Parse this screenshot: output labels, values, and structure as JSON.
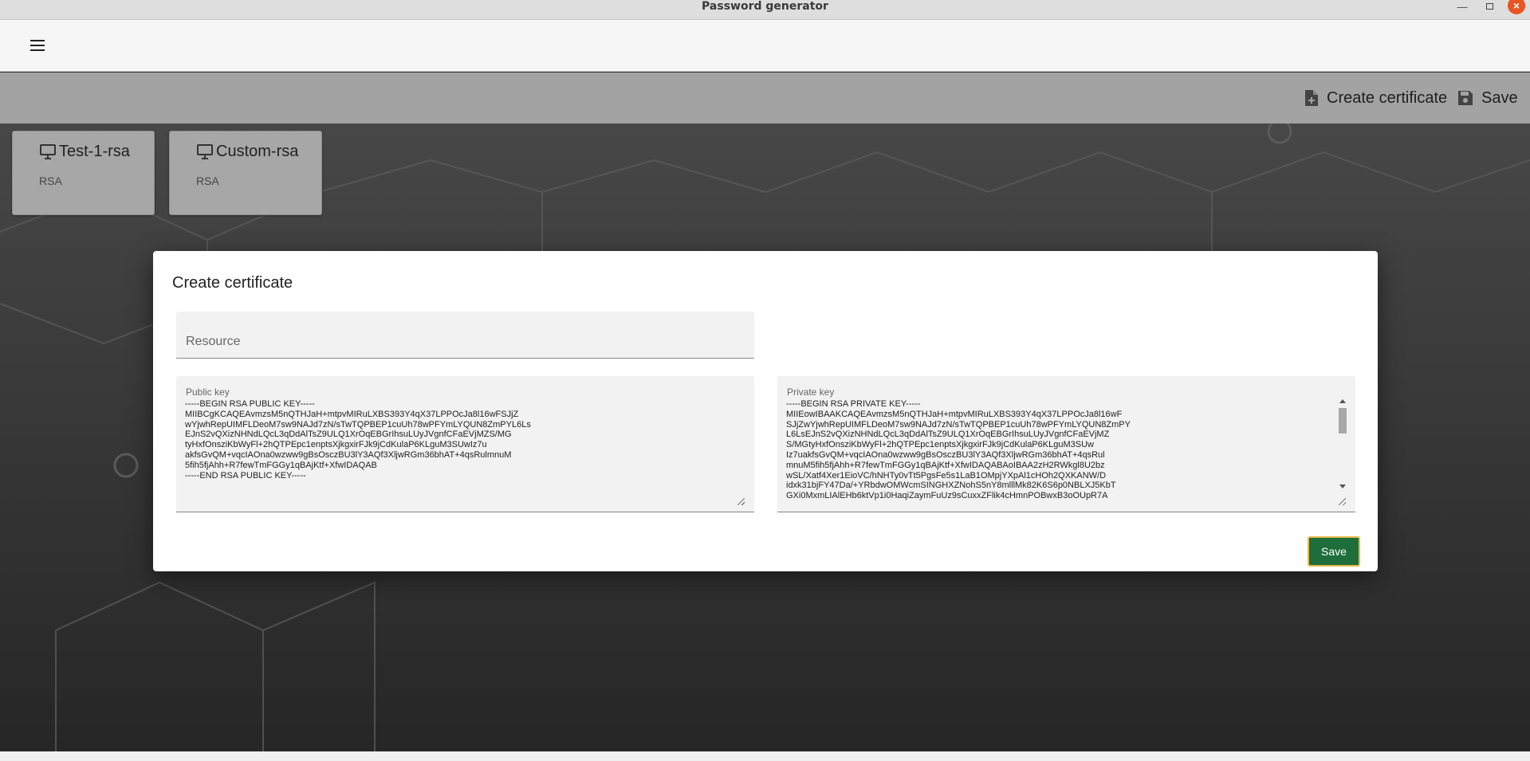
{
  "window": {
    "title": "Password generator"
  },
  "toolbar": {
    "create_label": "Create certificate",
    "save_label": "Save"
  },
  "certificates": [
    {
      "name": "Test-1-rsa",
      "type": "RSA"
    },
    {
      "name": "Custom-rsa",
      "type": "RSA"
    }
  ],
  "dialog": {
    "title": "Create certificate",
    "resource_placeholder": "Resource",
    "resource_value": "",
    "public_key_label": "Public key",
    "public_key": "-----BEGIN RSA PUBLIC KEY-----\nMIIBCgKCAQEAvmzsM5nQTHJaH+mtpvMIRuLXBS393Y4qX37LPPOcJa8l16wFSJjZ\nwYjwhRepUIMFLDeoM7sw9NAJd7zN/sTwTQPBEP1cuUh78wPFYmLYQUN8ZmPYL6Ls\nEJnS2vQXizNHNdLQcL3qDdAlTsZ9ULQ1XrOqEBGrIhsuLUyJVgnfCFaEVjMZS/MG\ntyHxfOnsziKbWyFl+2hQTPEpc1enptsXjkgxirFJk9jCdKulaP6KLguM3SUwIz7u\nakfsGvQM+vqcIAOna0wzww9gBsOsczBU3lY3AQf3XljwRGm36bhAT+4qsRulmnuM\n5fih5fjAhh+R7fewTmFGGy1qBAjKtf+XfwIDAQAB\n-----END RSA PUBLIC KEY-----",
    "private_key_label": "Private key",
    "private_key": "-----BEGIN RSA PRIVATE KEY-----\nMIIEowIBAAKCAQEAvmzsM5nQTHJaH+mtpvMIRuLXBS393Y4qX37LPPOcJa8l16wF\nSJjZwYjwhRepUIMFLDeoM7sw9NAJd7zN/sTwTQPBEP1cuUh78wPFYmLYQUN8ZmPY\nL6LsEJnS2vQXizNHNdLQcL3qDdAlTsZ9ULQ1XrOqEBGrIhsuLUyJVgnfCFaEVjMZ\nS/MGtyHxfOnsziKbWyFl+2hQTPEpc1enptsXjkgxirFJk9jCdKulaP6KLguM3SUw\nIz7uakfsGvQM+vqcIAOna0wzww9gBsOsczBU3lY3AQf3XljwRGm36bhAT+4qsRul\nmnuM5fih5fjAhh+R7fewTmFGGy1qBAjKtf+XfwIDAQABAoIBAA2zH2RWkgl8U2bz\nwSL/Xatf4Xer1EioVC/hNHTy0vTt5PgsFe5s1LaB1OMpjYXpAl1cHOh2QXKANW/D\nidxk31bjFY47Da/+YRbdwOMWcmSINGHXZNohS5nY8mlllMk82K6S6p0NBLXJ5KbT\nGXi0MxmLIAlEHb6ktVp1i0HaqiZaymFuUz9sCuxxZFlik4cHmnPOBwxB3oOUpR7A",
    "save_label": "Save"
  }
}
